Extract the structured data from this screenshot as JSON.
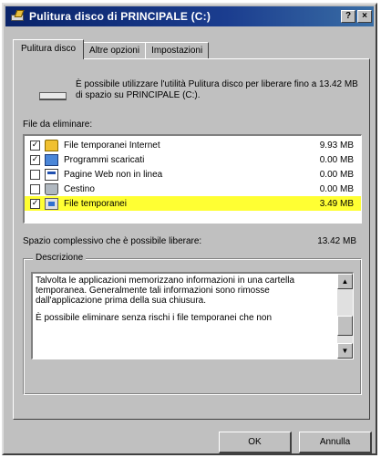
{
  "window": {
    "title": "Pulitura disco di PRINCIPALE (C:)",
    "help_label": "?",
    "close_label": "×"
  },
  "tabs": [
    {
      "label": "Pulitura disco",
      "active": true
    },
    {
      "label": "Altre opzioni",
      "active": false
    },
    {
      "label": "Impostazioni",
      "active": false
    }
  ],
  "intro": {
    "text": "È possibile utilizzare l'utilità Pulitura disco per liberare fino a 13.42 MB di spazio su PRINCIPALE (C:)."
  },
  "files": {
    "label": "File da eliminare:",
    "items": [
      {
        "name": "File temporanei Internet",
        "size": "9.93 MB",
        "checked": true,
        "icon": "internet-lock-icon"
      },
      {
        "name": "Programmi scaricati",
        "size": "0.00 MB",
        "checked": true,
        "icon": "program-icon"
      },
      {
        "name": "Pagine Web non in linea",
        "size": "0.00 MB",
        "checked": false,
        "icon": "web-page-icon"
      },
      {
        "name": "Cestino",
        "size": "0.00 MB",
        "checked": false,
        "icon": "recycle-bin-icon"
      },
      {
        "name": "File temporanei",
        "size": "3.49 MB",
        "checked": true,
        "icon": "temp-files-icon",
        "selected": true
      }
    ]
  },
  "space": {
    "label": "Spazio complessivo che è possibile liberare:",
    "value": "13.42 MB"
  },
  "description": {
    "legend": "Descrizione",
    "paragraph1": "Talvolta le applicazioni memorizzano informazioni in una cartella temporanea. Generalmente tali informazioni sono rimosse dall'applicazione prima della sua chiusura.",
    "paragraph2": "È possibile eliminare senza rischi i file temporanei che non"
  },
  "buttons": {
    "ok": "OK",
    "cancel": "Annulla"
  },
  "colors": {
    "title_bar": "#0a246a",
    "selection": "#ffff33",
    "face": "#c0c0c0"
  }
}
